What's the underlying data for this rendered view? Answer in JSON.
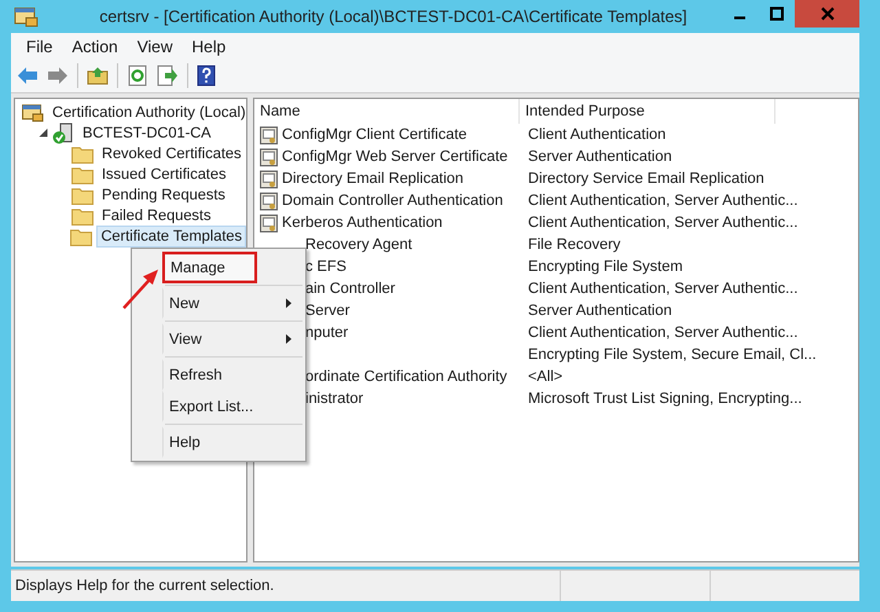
{
  "window": {
    "title": "certsrv - [Certification Authority (Local)\\BCTEST-DC01-CA\\Certificate Templates]"
  },
  "menu_bar": [
    "File",
    "Action",
    "View",
    "Help"
  ],
  "tree": {
    "label": "Certification Authority (Local)",
    "kind": "console",
    "children": [
      {
        "label": "BCTEST-DC01-CA",
        "kind": "server",
        "expanded": true,
        "selected": false,
        "children": [
          {
            "label": "Revoked Certificates",
            "kind": "folder",
            "selected": false
          },
          {
            "label": "Issued Certificates",
            "kind": "folder",
            "selected": false
          },
          {
            "label": "Pending Requests",
            "kind": "folder",
            "selected": false
          },
          {
            "label": "Failed Requests",
            "kind": "folder",
            "selected": false
          },
          {
            "label": "Certificate Templates",
            "kind": "folder",
            "selected": true
          }
        ]
      }
    ]
  },
  "table": {
    "columns": [
      "Name",
      "Intended Purpose"
    ],
    "rows": [
      {
        "kind": "full",
        "name": "ConfigMgr Client Certificate",
        "purpose": "Client Authentication"
      },
      {
        "kind": "full",
        "name": "ConfigMgr Web Server Certificate",
        "purpose": "Server Authentication"
      },
      {
        "kind": "full",
        "name": "Directory Email Replication",
        "purpose": "Directory Service Email Replication"
      },
      {
        "kind": "full",
        "name": "Domain Controller Authentication",
        "purpose": "Client Authentication, Server Authentic..."
      },
      {
        "kind": "full",
        "name": "Kerberos Authentication",
        "purpose": "Client Authentication, Server Authentic..."
      },
      {
        "kind": "partial",
        "name": "Recovery Agent",
        "purpose": "File Recovery"
      },
      {
        "kind": "partial",
        "name": "c EFS",
        "purpose": "Encrypting File System"
      },
      {
        "kind": "partial",
        "name": "ain Controller",
        "purpose": "Client Authentication, Server Authentic..."
      },
      {
        "kind": "partial",
        "name": "Server",
        "purpose": "Server Authentication"
      },
      {
        "kind": "partial",
        "name": "nputer",
        "purpose": "Client Authentication, Server Authentic..."
      },
      {
        "kind": "hidden",
        "purpose": "Encrypting File System, Secure Email, Cl..."
      },
      {
        "kind": "partial",
        "name": "ordinate Certification Authority",
        "purpose": "<All>"
      },
      {
        "kind": "partial",
        "name": "inistrator",
        "purpose": "Microsoft Trust List Signing, Encrypting..."
      }
    ]
  },
  "context_menu": {
    "items": [
      {
        "label": "Manage",
        "submenu": false,
        "highlighted": true
      },
      {
        "label": "New",
        "submenu": true,
        "highlighted": false,
        "separator_before": true
      },
      {
        "label": "View",
        "submenu": true,
        "highlighted": false,
        "separator_before": true
      },
      {
        "label": "Refresh",
        "submenu": false,
        "highlighted": false,
        "separator_before": true
      },
      {
        "label": "Export List...",
        "submenu": false,
        "highlighted": false
      },
      {
        "label": "Help",
        "submenu": false,
        "highlighted": false,
        "separator_before": true
      }
    ],
    "pointer_arrow": true
  },
  "status_bar": {
    "text": "Displays Help for the current selection."
  }
}
